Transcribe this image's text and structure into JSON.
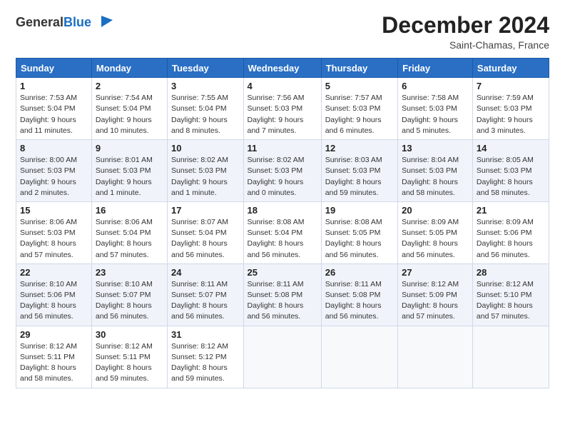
{
  "header": {
    "logo_general": "General",
    "logo_blue": "Blue",
    "month_year": "December 2024",
    "location": "Saint-Chamas, France"
  },
  "weekdays": [
    "Sunday",
    "Monday",
    "Tuesday",
    "Wednesday",
    "Thursday",
    "Friday",
    "Saturday"
  ],
  "weeks": [
    [
      {
        "day": "1",
        "info": "Sunrise: 7:53 AM\nSunset: 5:04 PM\nDaylight: 9 hours and 11 minutes."
      },
      {
        "day": "2",
        "info": "Sunrise: 7:54 AM\nSunset: 5:04 PM\nDaylight: 9 hours and 10 minutes."
      },
      {
        "day": "3",
        "info": "Sunrise: 7:55 AM\nSunset: 5:04 PM\nDaylight: 9 hours and 8 minutes."
      },
      {
        "day": "4",
        "info": "Sunrise: 7:56 AM\nSunset: 5:03 PM\nDaylight: 9 hours and 7 minutes."
      },
      {
        "day": "5",
        "info": "Sunrise: 7:57 AM\nSunset: 5:03 PM\nDaylight: 9 hours and 6 minutes."
      },
      {
        "day": "6",
        "info": "Sunrise: 7:58 AM\nSunset: 5:03 PM\nDaylight: 9 hours and 5 minutes."
      },
      {
        "day": "7",
        "info": "Sunrise: 7:59 AM\nSunset: 5:03 PM\nDaylight: 9 hours and 3 minutes."
      }
    ],
    [
      {
        "day": "8",
        "info": "Sunrise: 8:00 AM\nSunset: 5:03 PM\nDaylight: 9 hours and 2 minutes."
      },
      {
        "day": "9",
        "info": "Sunrise: 8:01 AM\nSunset: 5:03 PM\nDaylight: 9 hours and 1 minute."
      },
      {
        "day": "10",
        "info": "Sunrise: 8:02 AM\nSunset: 5:03 PM\nDaylight: 9 hours and 1 minute."
      },
      {
        "day": "11",
        "info": "Sunrise: 8:02 AM\nSunset: 5:03 PM\nDaylight: 9 hours and 0 minutes."
      },
      {
        "day": "12",
        "info": "Sunrise: 8:03 AM\nSunset: 5:03 PM\nDaylight: 8 hours and 59 minutes."
      },
      {
        "day": "13",
        "info": "Sunrise: 8:04 AM\nSunset: 5:03 PM\nDaylight: 8 hours and 58 minutes."
      },
      {
        "day": "14",
        "info": "Sunrise: 8:05 AM\nSunset: 5:03 PM\nDaylight: 8 hours and 58 minutes."
      }
    ],
    [
      {
        "day": "15",
        "info": "Sunrise: 8:06 AM\nSunset: 5:03 PM\nDaylight: 8 hours and 57 minutes."
      },
      {
        "day": "16",
        "info": "Sunrise: 8:06 AM\nSunset: 5:04 PM\nDaylight: 8 hours and 57 minutes."
      },
      {
        "day": "17",
        "info": "Sunrise: 8:07 AM\nSunset: 5:04 PM\nDaylight: 8 hours and 56 minutes."
      },
      {
        "day": "18",
        "info": "Sunrise: 8:08 AM\nSunset: 5:04 PM\nDaylight: 8 hours and 56 minutes."
      },
      {
        "day": "19",
        "info": "Sunrise: 8:08 AM\nSunset: 5:05 PM\nDaylight: 8 hours and 56 minutes."
      },
      {
        "day": "20",
        "info": "Sunrise: 8:09 AM\nSunset: 5:05 PM\nDaylight: 8 hours and 56 minutes."
      },
      {
        "day": "21",
        "info": "Sunrise: 8:09 AM\nSunset: 5:06 PM\nDaylight: 8 hours and 56 minutes."
      }
    ],
    [
      {
        "day": "22",
        "info": "Sunrise: 8:10 AM\nSunset: 5:06 PM\nDaylight: 8 hours and 56 minutes."
      },
      {
        "day": "23",
        "info": "Sunrise: 8:10 AM\nSunset: 5:07 PM\nDaylight: 8 hours and 56 minutes."
      },
      {
        "day": "24",
        "info": "Sunrise: 8:11 AM\nSunset: 5:07 PM\nDaylight: 8 hours and 56 minutes."
      },
      {
        "day": "25",
        "info": "Sunrise: 8:11 AM\nSunset: 5:08 PM\nDaylight: 8 hours and 56 minutes."
      },
      {
        "day": "26",
        "info": "Sunrise: 8:11 AM\nSunset: 5:08 PM\nDaylight: 8 hours and 56 minutes."
      },
      {
        "day": "27",
        "info": "Sunrise: 8:12 AM\nSunset: 5:09 PM\nDaylight: 8 hours and 57 minutes."
      },
      {
        "day": "28",
        "info": "Sunrise: 8:12 AM\nSunset: 5:10 PM\nDaylight: 8 hours and 57 minutes."
      }
    ],
    [
      {
        "day": "29",
        "info": "Sunrise: 8:12 AM\nSunset: 5:11 PM\nDaylight: 8 hours and 58 minutes."
      },
      {
        "day": "30",
        "info": "Sunrise: 8:12 AM\nSunset: 5:11 PM\nDaylight: 8 hours and 59 minutes."
      },
      {
        "day": "31",
        "info": "Sunrise: 8:12 AM\nSunset: 5:12 PM\nDaylight: 8 hours and 59 minutes."
      },
      null,
      null,
      null,
      null
    ]
  ]
}
